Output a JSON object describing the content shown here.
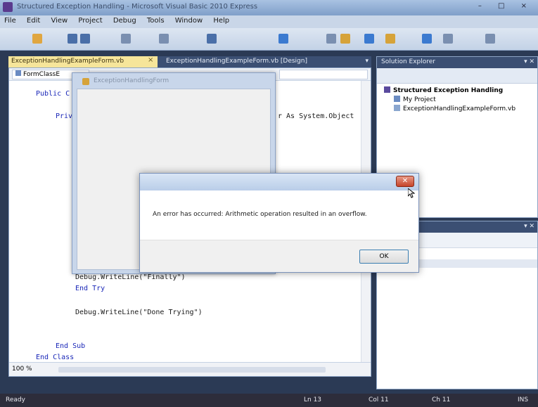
{
  "window": {
    "title": "Structured Exception Handling - Microsoft Visual Basic 2010 Express",
    "controls": "– □ ×"
  },
  "menu": [
    "File",
    "Edit",
    "View",
    "Project",
    "Debug",
    "Tools",
    "Window",
    "Help"
  ],
  "editor": {
    "active_tab": "ExceptionHandlingExampleForm.vb",
    "active_tab_close": "×",
    "inactive_tab": "ExceptionHandlingExampleForm.vb [Design]",
    "nav_class": "FormClassE",
    "zoom": "100 %",
    "code": {
      "line_public": "Public C",
      "line_private": "Priv",
      "line_sender": "r As System.Object",
      "line_finally_call": "Debug.WriteLine(\"Finally\")",
      "line_end_try": "End Try",
      "line_done_call": "Debug.WriteLine(\"Done Trying\")",
      "line_end_sub": "End Sub",
      "line_end_class": "End Class"
    }
  },
  "solution_explorer": {
    "title": "Solution Explorer",
    "items": [
      "Structured Exception Handling",
      "My Project",
      "ExceptionHandlingExampleForm.vb"
    ]
  },
  "form_window": {
    "title": "ExceptionHandlingForm"
  },
  "message_box": {
    "message": "An error has occurred: Arithmetic operation resulted in an overflow.",
    "ok_label": "OK",
    "close_glyph": "✕"
  },
  "status": {
    "ready": "Ready",
    "ln": "Ln 13",
    "col": "Col 11",
    "ch": "Ch 11",
    "ins": "INS"
  },
  "colors": {
    "accent_tab": "#f6e59a",
    "keyword": "#1a27b8",
    "string": "#a3151e"
  }
}
